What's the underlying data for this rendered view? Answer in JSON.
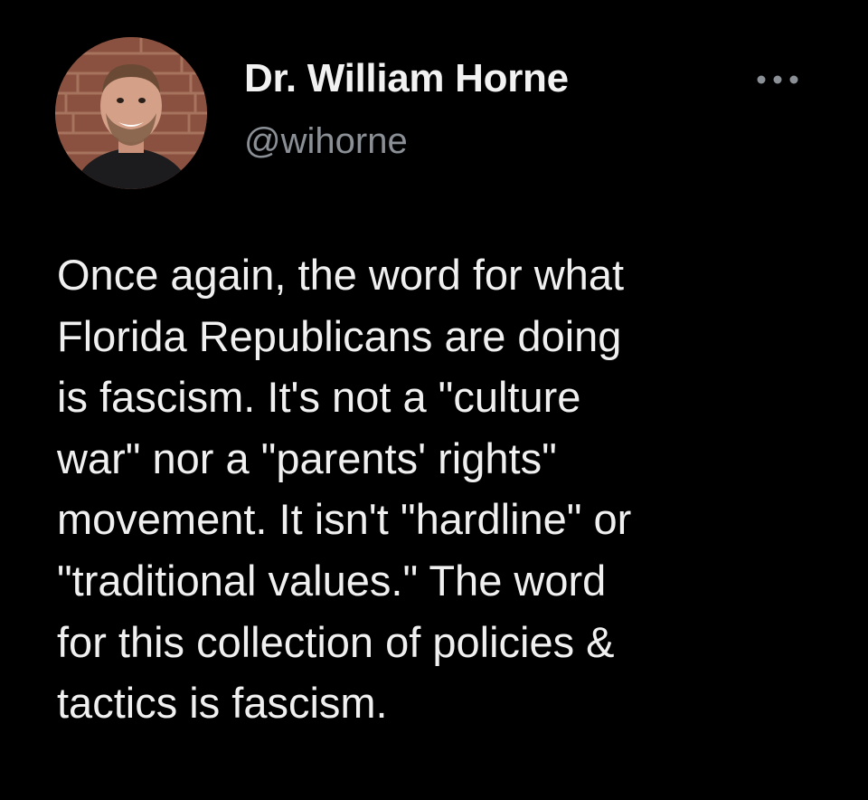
{
  "tweet": {
    "author": {
      "name": "Dr. William Horne",
      "handle": "@wihorne",
      "avatar_icon": "profile-photo"
    },
    "menu_icon": "more-horizontal-icon",
    "text_lines": [
      "Once again, the word for what",
      "Florida Republicans are doing",
      "is fascism. It's not a \"culture",
      "war\" nor a \"parents' rights\"",
      "movement. It isn't \"hardline\" or",
      "\"traditional values.\" The word",
      "for this collection of policies &",
      "tactics is fascism."
    ]
  },
  "colors": {
    "background": "#000000",
    "name": "#f2f2f2",
    "handle": "#8b9096",
    "body_text": "#f0f0f0"
  }
}
